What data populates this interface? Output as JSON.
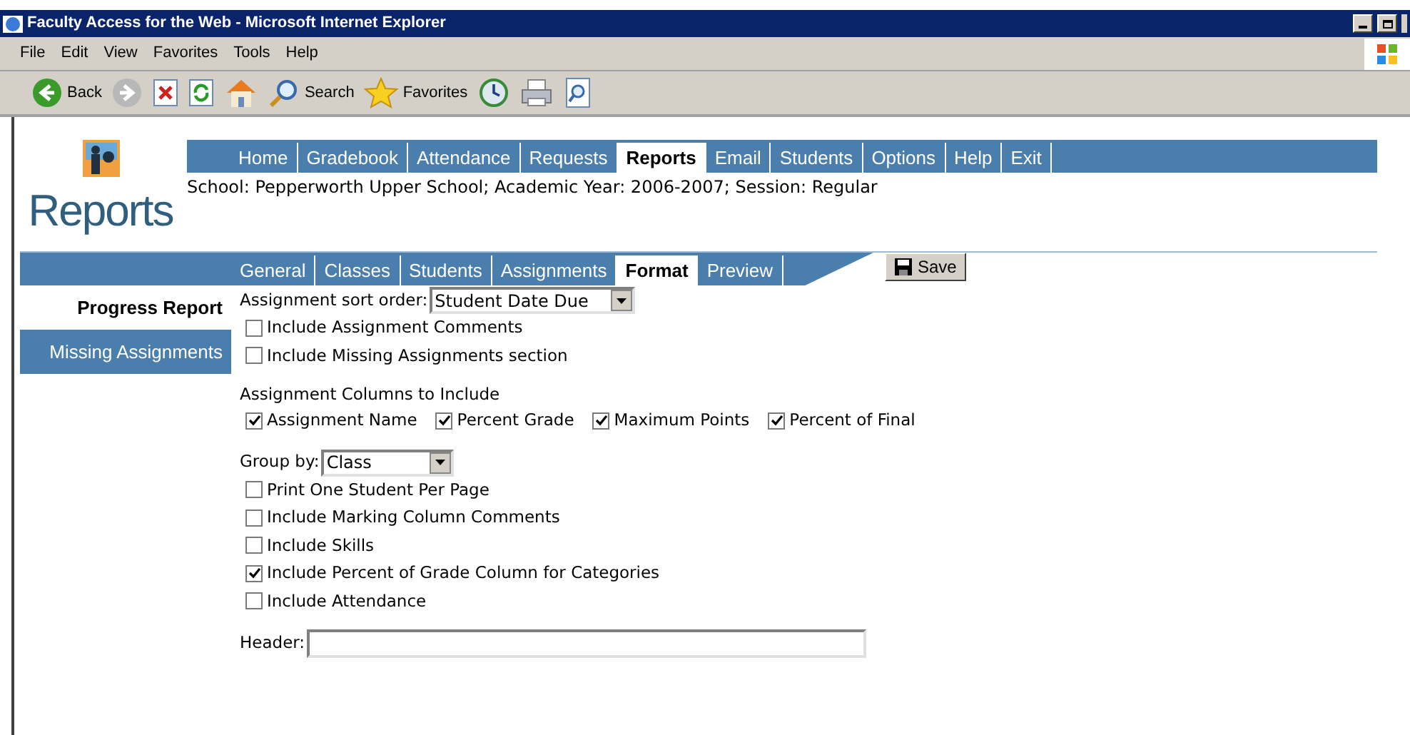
{
  "window": {
    "title": "Faculty Access for the Web - Microsoft Internet Explorer"
  },
  "menu": [
    "File",
    "Edit",
    "View",
    "Favorites",
    "Tools",
    "Help"
  ],
  "toolbar": [
    {
      "kind": "back",
      "label": "Back"
    },
    {
      "kind": "forward"
    },
    {
      "kind": "stop"
    },
    {
      "kind": "refresh"
    },
    {
      "kind": "home"
    },
    {
      "kind": "search",
      "label": "Search"
    },
    {
      "kind": "favorites",
      "label": "Favorites"
    },
    {
      "kind": "history"
    },
    {
      "kind": "print"
    },
    {
      "kind": "preview"
    }
  ],
  "nav": [
    {
      "label": "Home",
      "selected": false
    },
    {
      "label": "Gradebook",
      "selected": false
    },
    {
      "label": "Attendance",
      "selected": false
    },
    {
      "label": "Requests",
      "selected": false
    },
    {
      "label": "Reports",
      "selected": true
    },
    {
      "label": "Email",
      "selected": false
    },
    {
      "label": "Students",
      "selected": false
    },
    {
      "label": "Options",
      "selected": false
    },
    {
      "label": "Help",
      "selected": false
    },
    {
      "label": "Exit",
      "selected": false
    }
  ],
  "school_line": "School: Pepperworth Upper School; Academic Year: 2006-2007; Session: Regular",
  "page_title": "Reports",
  "subtabs": [
    {
      "label": "General",
      "selected": false
    },
    {
      "label": "Classes",
      "selected": false
    },
    {
      "label": "Students",
      "selected": false
    },
    {
      "label": "Assignments",
      "selected": false
    },
    {
      "label": "Format",
      "selected": true
    },
    {
      "label": "Preview",
      "selected": false
    }
  ],
  "save_button": "Save",
  "sidebar": [
    {
      "label": "Progress Report",
      "selected": true
    },
    {
      "label": "Missing Assignments",
      "selected": false
    }
  ],
  "form": {
    "sort_order": {
      "label": "Assignment sort order:",
      "value": "Student Date Due"
    },
    "options_1": [
      {
        "label": "Include Assignment Comments",
        "checked": false
      },
      {
        "label": "Include Missing Assignments section",
        "checked": false
      }
    ],
    "columns_heading": "Assignment Columns to Include",
    "columns": [
      {
        "label": "Assignment Name",
        "checked": true
      },
      {
        "label": "Percent Grade",
        "checked": true
      },
      {
        "label": "Maximum Points",
        "checked": true
      },
      {
        "label": "Percent of Final",
        "checked": true
      }
    ],
    "group_by": {
      "label": "Group by:",
      "value": "Class"
    },
    "options_2": [
      {
        "label": "Print One Student Per Page",
        "checked": false
      },
      {
        "label": "Include Marking Column Comments",
        "checked": false
      },
      {
        "label": "Include Skills",
        "checked": false
      },
      {
        "label": "Include Percent of Grade Column for Categories",
        "checked": true
      },
      {
        "label": "Include Attendance",
        "checked": false
      }
    ],
    "header": {
      "label": "Header:"
    }
  }
}
